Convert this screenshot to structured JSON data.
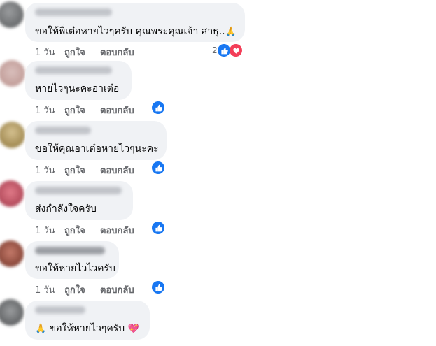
{
  "comments": [
    {
      "text": "ขอให้พี่เต๋อหายไวๆครับ คุณพระคุณเจ้า สาธุ..",
      "time": "1 วัน",
      "like": "ถูกใจ",
      "reply": "ตอบกลับ",
      "reactions": "2",
      "reaction_icons": [
        "like-icon",
        "heart-icon"
      ],
      "avatar_color": "#7c7e80"
    },
    {
      "text": "หายไวๆนะคะอาเต๋อ",
      "time": "1 วัน",
      "like": "ถูกใจ",
      "reply": "ตอบกลับ",
      "reaction_icons": [
        "like-icon"
      ],
      "avatar_color": "#c9a6a3"
    },
    {
      "text": "ขอให้คุณอาเต๋อหายไวๆนะคะ",
      "time": "1 วัน",
      "like": "ถูกใจ",
      "reply": "ตอบกลับ",
      "reaction_icons": [
        "like-icon"
      ],
      "avatar_color": "#b59c63"
    },
    {
      "text": "ส่งกำลังใจครับ",
      "time": "1 วัน",
      "like": "ถูกใจ",
      "reply": "ตอบกลับ",
      "reaction_icons": [
        "like-icon"
      ],
      "avatar_color": "#c55a6a"
    },
    {
      "text": "ขอให้หายไวไวครับ",
      "time": "1 วัน",
      "like": "ถูกใจ",
      "reply": "ตอบกลับ",
      "reaction_icons": [
        "like-icon"
      ],
      "avatar_color": "#9a4a3d"
    },
    {
      "text": "ขอให้หายไวๆครับ",
      "time": "",
      "like": "",
      "reply": "",
      "reaction_icons": [],
      "avatar_color": "#6d6f72"
    }
  ],
  "colors": {
    "bubble": "#f0f2f5",
    "like_blue": "#1877f2",
    "heart_red": "#f33e58",
    "meta_gray": "#65676b"
  }
}
